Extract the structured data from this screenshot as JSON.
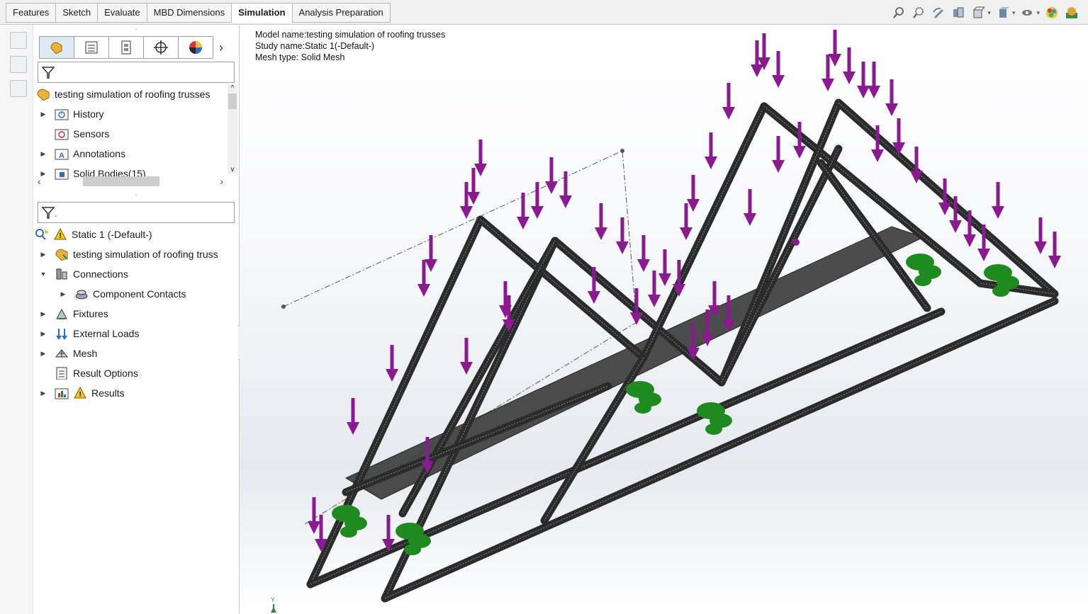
{
  "tabs": [
    {
      "label": "Features",
      "active": false
    },
    {
      "label": "Sketch",
      "active": false
    },
    {
      "label": "Evaluate",
      "active": false
    },
    {
      "label": "MBD Dimensions",
      "active": false
    },
    {
      "label": "Simulation",
      "active": true
    },
    {
      "label": "Analysis Preparation",
      "active": false
    }
  ],
  "heads_up_icons": [
    "zoom-to-fit-icon",
    "zoom-to-area-icon",
    "previous-view-icon",
    "section-view-icon",
    "view-orientation-icon",
    "display-style-icon",
    "hide-show-items-icon",
    "edit-appearance-icon",
    "apply-scene-icon"
  ],
  "feature_tree": {
    "root_label": "testing simulation of roofing trusses",
    "items": [
      {
        "label": "History",
        "icon": "history-folder-icon",
        "expandable": true
      },
      {
        "label": "Sensors",
        "icon": "sensors-folder-icon",
        "expandable": false
      },
      {
        "label": "Annotations",
        "icon": "annotations-folder-icon",
        "expandable": true
      },
      {
        "label": "Solid Bodies(15)",
        "icon": "solid-bodies-folder-icon",
        "expandable": true
      }
    ]
  },
  "study_tree": {
    "study_label": "Static 1 (-Default-)",
    "items": [
      {
        "label": "testing simulation of roofing truss",
        "icon": "part-icon",
        "arrow": "right",
        "indent": 0
      },
      {
        "label": "Connections",
        "icon": "connections-icon",
        "arrow": "down",
        "indent": 0
      },
      {
        "label": "Component Contacts",
        "icon": "component-contacts-icon",
        "arrow": "right",
        "indent": 1
      },
      {
        "label": "Fixtures",
        "icon": "fixtures-icon",
        "arrow": "right",
        "indent": 0
      },
      {
        "label": "External Loads",
        "icon": "external-loads-icon",
        "arrow": "right",
        "indent": 0
      },
      {
        "label": "Mesh",
        "icon": "mesh-icon",
        "arrow": "right",
        "indent": 0
      },
      {
        "label": "Result Options",
        "icon": "result-options-icon",
        "arrow": "",
        "indent": 0
      },
      {
        "label": "Results",
        "icon": "results-icon",
        "arrow": "right",
        "indent": 0,
        "warning": true
      }
    ]
  },
  "info": {
    "model_line": "Model name:testing simulation of roofing trusses",
    "study_line": "Study name:Static 1(-Default-)",
    "mesh_line": "Mesh type: Solid Mesh"
  },
  "colors": {
    "load_arrow": "#8a1a8f",
    "fixture": "#1f8a1f",
    "mesh": "#2b2b2b",
    "active_tab": "#ffffff"
  }
}
